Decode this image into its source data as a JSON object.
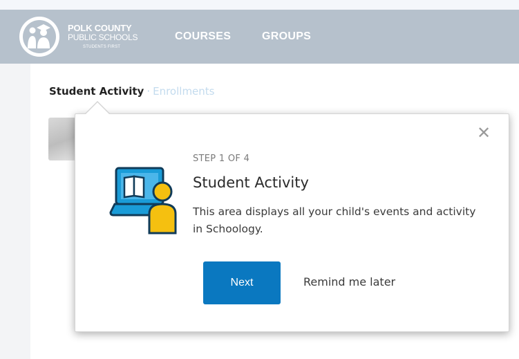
{
  "header": {
    "logo": {
      "line1": "POLK COUNTY",
      "line2": "PUBLIC SCHOOLS",
      "tagline": "STUDENTS FIRST",
      "icon": "polk-schools-logo-icon"
    },
    "nav": [
      {
        "label": "COURSES"
      },
      {
        "label": "GROUPS"
      }
    ],
    "bg_color": "#b6c1cc"
  },
  "tabs": {
    "active": "Student Activity",
    "separator": "·",
    "inactive": "Enrollments"
  },
  "tour": {
    "step": "STEP 1 OF 4",
    "title": "Student Activity",
    "description": "This area displays all your child's events and activity in Schoology.",
    "next_label": "Next",
    "remind_label": "Remind me later",
    "close_icon": "close-icon",
    "illustration": "laptop-book-student-icon",
    "accent_color": "#0a78c0"
  }
}
